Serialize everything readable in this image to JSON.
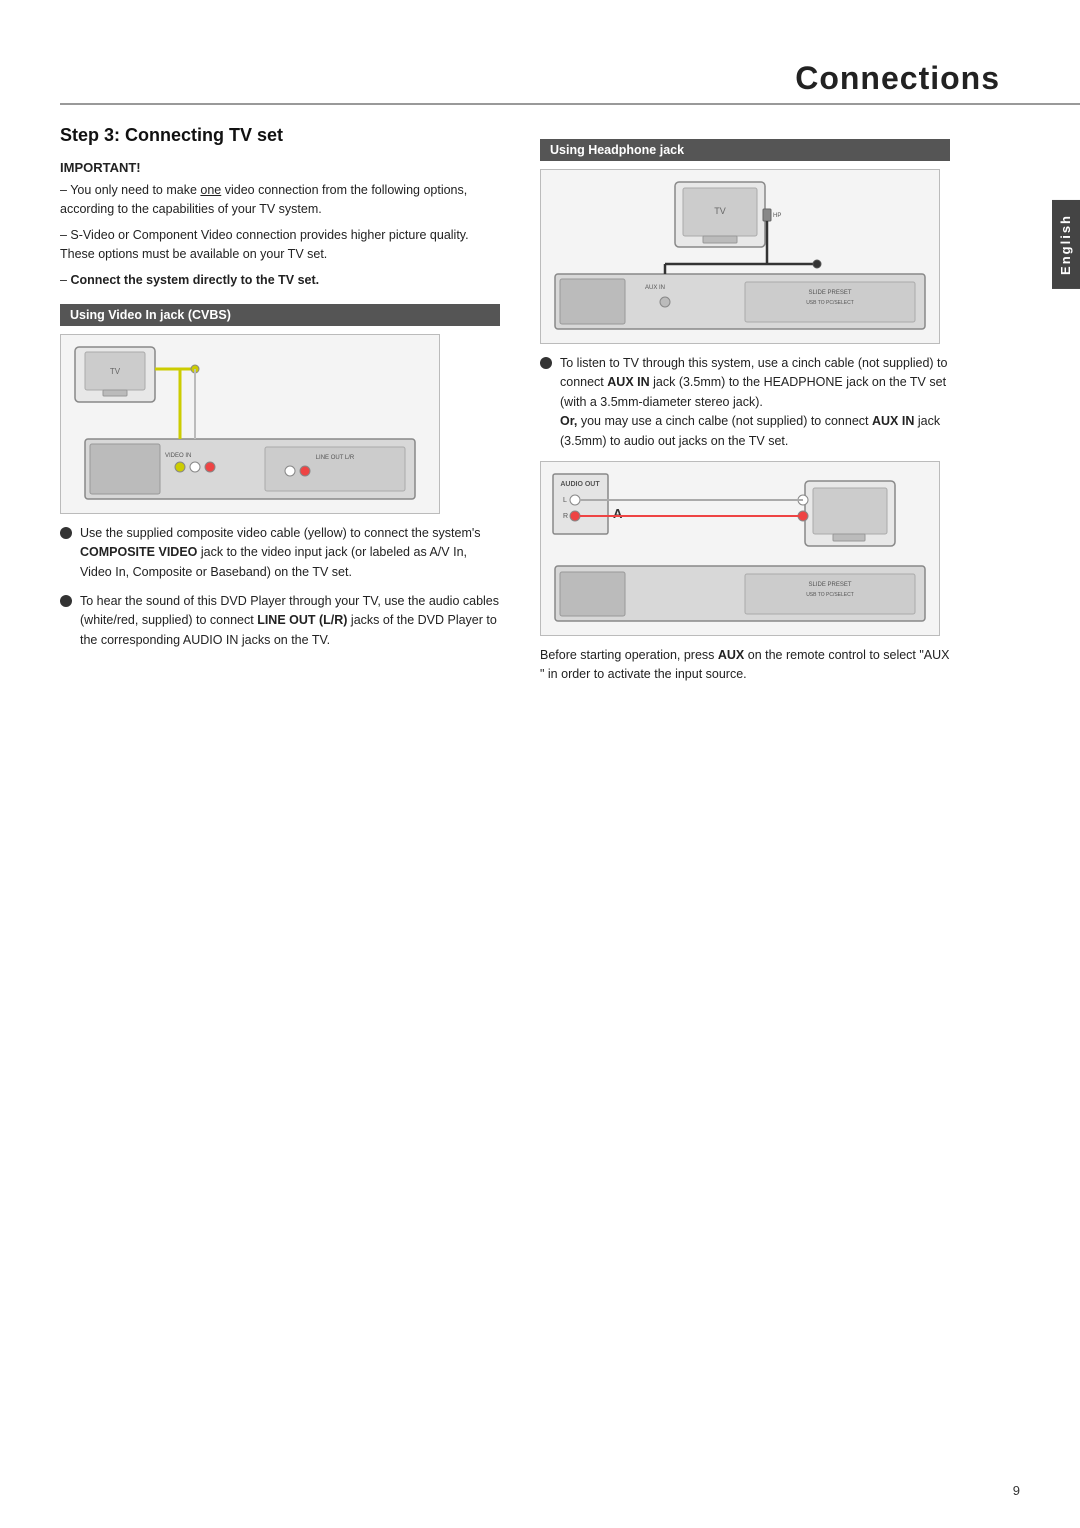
{
  "page": {
    "title": "Connections",
    "page_number": "9",
    "language": "English"
  },
  "step": {
    "heading": "Step 3:    Connecting TV set"
  },
  "important": {
    "label": "IMPORTANT!",
    "lines": [
      "– You only need to make one video connection from the following options, according to the capabilities of your TV system.",
      "– S-Video or Component Video connection provides higher picture quality. These options must be available on your TV set.",
      "– Connect the system directly to the TV set."
    ]
  },
  "left_section": {
    "bar": "Using  Video In jack (CVBS)",
    "bullet1": {
      "text_start": "Use the supplied composite video cable (yellow) to connect the system's ",
      "bold1": "COMPOSITE VIDEO",
      "text_mid": " jack to the video input jack (or labeled as A/V In, Video In, Composite or Baseband) on the TV set."
    },
    "bullet2": {
      "text_start": "To hear the sound of this DVD Player through your TV, use the audio cables (white/red, supplied) to connect ",
      "bold1": "LINE OUT (L/R)",
      "text_mid": " jacks of the DVD Player to the corresponding AUDIO IN jacks on the TV."
    }
  },
  "right_section": {
    "bar": "Using  Headphone jack",
    "bullet1": {
      "text_start": "To listen to TV through this system, use a cinch cable (not supplied) to connect ",
      "bold1": "AUX IN",
      "text_mid": " jack (3.5mm) to the HEADPHONE jack on the TV set (with a 3.5mm-diameter stereo jack)."
    },
    "or_text": {
      "bold1": "Or,",
      "text": " you may use a cinch calbe (not supplied) to connect ",
      "bold2": "AUX IN",
      "text2": " jack (3.5mm) to audio out jacks on the TV set."
    },
    "before_text": {
      "text_start": "Before starting operation, press ",
      "bold1": "AUX",
      "text_mid": " on the remote control to select \"AUX \" in order to activate the input source."
    }
  }
}
